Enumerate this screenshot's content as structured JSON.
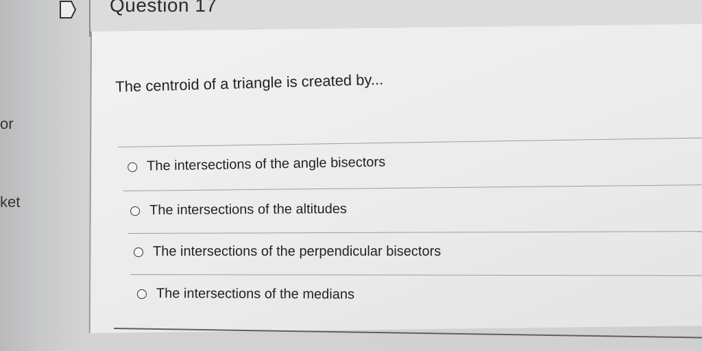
{
  "sidebar": {
    "partial_label_1": "or",
    "partial_label_2": "ket"
  },
  "header": {
    "title": "Question 17",
    "flag_icon": "flag-outline-icon"
  },
  "question": {
    "prompt": "The centroid of a triangle is created by..."
  },
  "options": [
    {
      "label": "The intersections of the angle bisectors",
      "selected": false
    },
    {
      "label": "The intersections of the altitudes",
      "selected": false
    },
    {
      "label": "The intersections of the perpendicular bisectors",
      "selected": false
    },
    {
      "label": "The intersections of the medians",
      "selected": false
    }
  ]
}
